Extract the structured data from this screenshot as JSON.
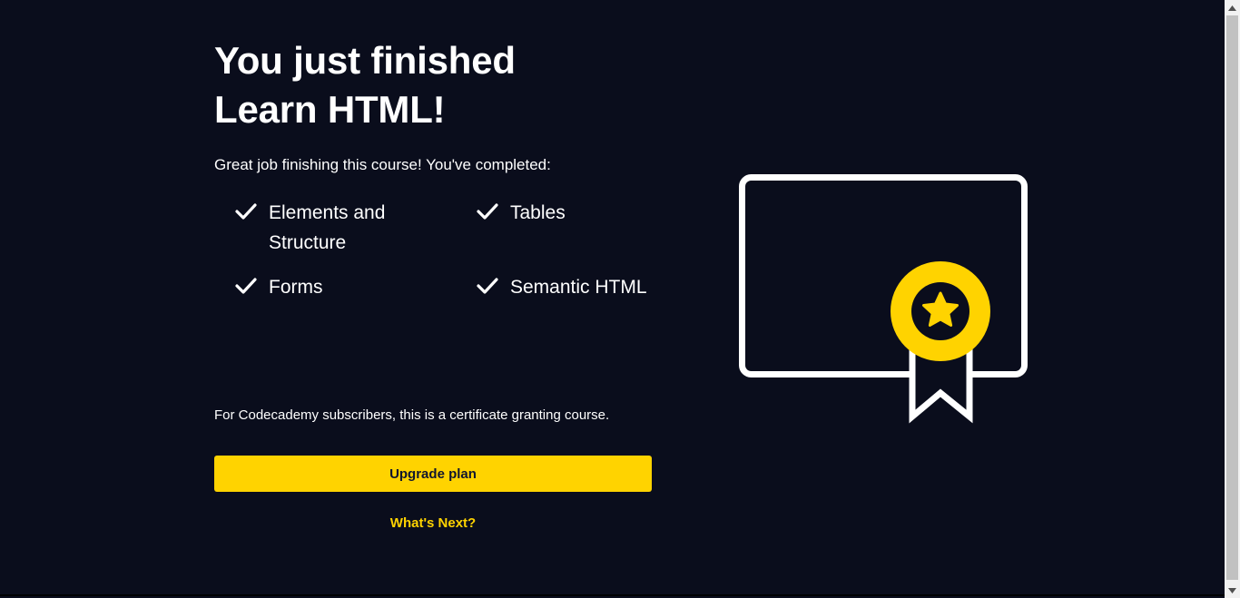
{
  "header": {
    "title_line1": "You just finished",
    "title_line2": "Learn HTML!"
  },
  "intro": "Great job finishing this course! You've completed:",
  "completed_items": [
    {
      "label": "Elements and Structure",
      "icon": "check-icon"
    },
    {
      "label": "Tables",
      "icon": "check-icon"
    },
    {
      "label": "Forms",
      "icon": "check-icon"
    },
    {
      "label": "Semantic HTML",
      "icon": "check-icon"
    }
  ],
  "certificate_note": "For Codecademy subscribers, this is a certificate granting course.",
  "actions": {
    "upgrade_label": "Upgrade plan",
    "whats_next_label": "What's Next?"
  },
  "colors": {
    "background": "#0a0d1c",
    "accent": "#ffd300",
    "text": "#ffffff"
  },
  "illustration": {
    "icon": "certificate-ribbon-icon"
  }
}
